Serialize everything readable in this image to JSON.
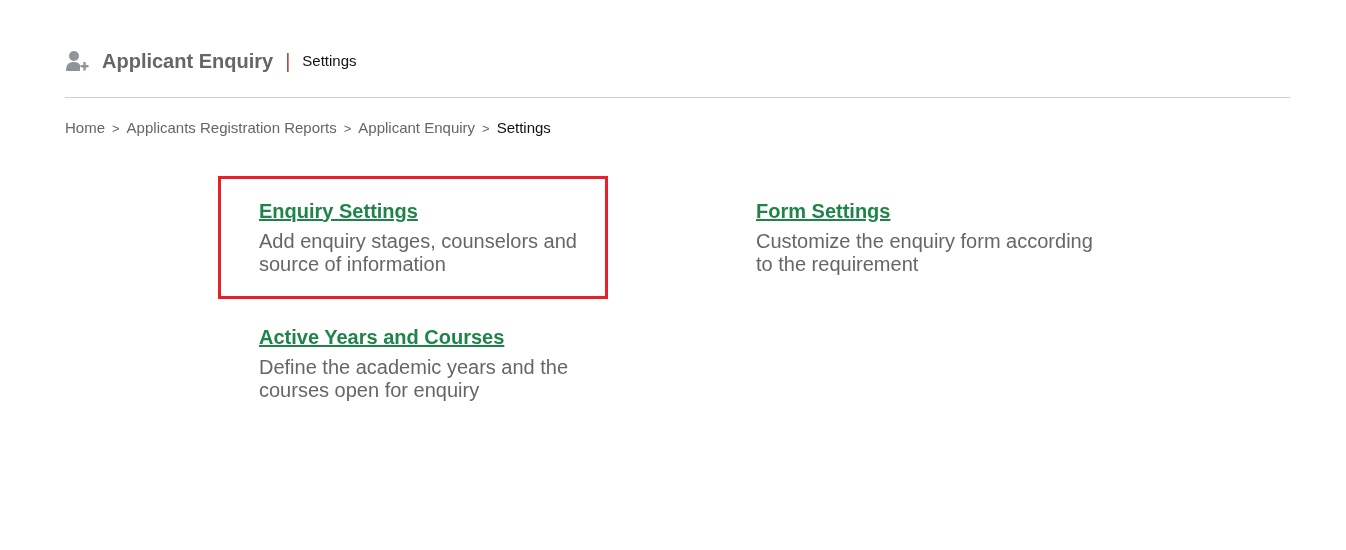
{
  "header": {
    "title": "Applicant Enquiry",
    "divider": "|",
    "subtitle": "Settings"
  },
  "breadcrumb": [
    {
      "kind": "link",
      "label": "Home"
    },
    {
      "kind": "separator",
      "label": ">"
    },
    {
      "kind": "link",
      "label": "Applicants Registration Reports"
    },
    {
      "kind": "separator",
      "label": ">"
    },
    {
      "kind": "link",
      "label": "Applicant Enquiry"
    },
    {
      "kind": "separator",
      "label": ">"
    },
    {
      "kind": "current",
      "label": "Settings"
    }
  ],
  "cards": [
    {
      "title": "Enquiry Settings",
      "description": "Add enquiry stages, counselors and source of information",
      "highlighted": true
    },
    {
      "title": "Form Settings",
      "description": "Customize the enquiry form according to the requirement",
      "highlighted": false
    },
    {
      "title": "Active Years and Courses",
      "description": "Define the academic years and the courses open for enquiry",
      "highlighted": false
    }
  ]
}
